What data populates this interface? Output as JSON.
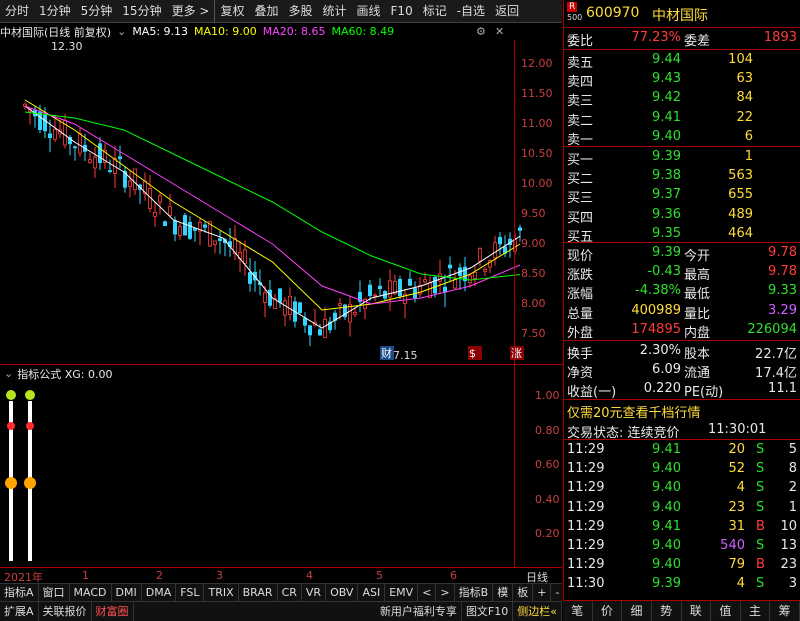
{
  "toolbar": {
    "items": [
      "分时",
      "1分钟",
      "5分钟",
      "15分钟",
      "更多 >",
      "复权",
      "叠加",
      "多股",
      "统计",
      "画线",
      "F10",
      "标记",
      "-自选",
      "返回"
    ]
  },
  "chart_header": {
    "title": "中材国际(日线 前复权)",
    "ma5": "MA5: 9.13",
    "ma10": "MA10: 9.00",
    "ma20": "MA20: 8.65",
    "ma60": "MA60: 8.49",
    "colors": {
      "ma5": "#ffffff",
      "ma10": "#ffff00",
      "ma20": "#ff40ff",
      "ma60": "#00ff00"
    }
  },
  "price_axis": {
    "ticks": [
      "12.00",
      "11.50",
      "11.00",
      "10.50",
      "10.00",
      "9.50",
      "9.00",
      "8.50",
      "8.00",
      "7.50"
    ],
    "high_label": "12.30",
    "low_label": "7.15",
    "markers": [
      "财",
      "$",
      "涨"
    ]
  },
  "indicator": {
    "title": "指标公式 XG: 0.00",
    "ticks": [
      "1.00",
      "0.80",
      "0.60",
      "0.40",
      "0.20"
    ]
  },
  "date_axis": {
    "labels": [
      "2021年",
      "1",
      "2",
      "3",
      "4",
      "5",
      "6"
    ],
    "right_label": "日线"
  },
  "tabs_row1": {
    "items": [
      "指标A",
      "窗口",
      "MACD",
      "DMI",
      "DMA",
      "FSL",
      "TRIX",
      "BRAR",
      "CR",
      "VR",
      "OBV",
      "ASI",
      "EMV",
      "<",
      ">",
      "指标B",
      "模",
      "板",
      "+",
      "-"
    ]
  },
  "tabs_row2": {
    "items": [
      "扩展A",
      "关联报价",
      "财富圈"
    ],
    "right_items": [
      "新用户福利专享",
      "图文F10",
      "侧边栏«"
    ]
  },
  "stock": {
    "r_badge": "R",
    "r_num": "500",
    "code": "600970",
    "name": "中材国际"
  },
  "order_book": {
    "wb_label": "委比",
    "wb_value": "77.23%",
    "wc_label": "委差",
    "wc_value": "1893",
    "asks": [
      {
        "label": "卖五",
        "price": "9.44",
        "vol": "104"
      },
      {
        "label": "卖四",
        "price": "9.43",
        "vol": "63"
      },
      {
        "label": "卖三",
        "price": "9.42",
        "vol": "84"
      },
      {
        "label": "卖二",
        "price": "9.41",
        "vol": "22"
      },
      {
        "label": "卖一",
        "price": "9.40",
        "vol": "6"
      }
    ],
    "bids": [
      {
        "label": "买一",
        "price": "9.39",
        "vol": "1"
      },
      {
        "label": "买二",
        "price": "9.38",
        "vol": "563"
      },
      {
        "label": "买三",
        "price": "9.37",
        "vol": "655"
      },
      {
        "label": "买四",
        "price": "9.36",
        "vol": "489"
      },
      {
        "label": "买五",
        "price": "9.35",
        "vol": "464"
      }
    ]
  },
  "quote": {
    "rows": [
      {
        "l1": "现价",
        "v1": "9.39",
        "c1": "green",
        "l2": "今开",
        "v2": "9.78",
        "c2": "red"
      },
      {
        "l1": "涨跌",
        "v1": "-0.43",
        "c1": "green",
        "l2": "最高",
        "v2": "9.78",
        "c2": "red"
      },
      {
        "l1": "涨幅",
        "v1": "-4.38%",
        "c1": "green",
        "l2": "最低",
        "v2": "9.33",
        "c2": "green"
      },
      {
        "l1": "总量",
        "v1": "400989",
        "c1": "yellow",
        "l2": "量比",
        "v2": "3.29",
        "c2": "purple"
      },
      {
        "l1": "外盘",
        "v1": "174895",
        "c1": "red",
        "l2": "内盘",
        "v2": "226094",
        "c2": "green"
      }
    ],
    "rows2": [
      {
        "l1": "换手",
        "v1": "2.30%",
        "l2": "股本",
        "v2": "22.7亿"
      },
      {
        "l1": "净资",
        "v1": "6.09",
        "l2": "流通",
        "v2": "17.4亿"
      },
      {
        "l1": "收益(一)",
        "v1": "0.220",
        "l2": "PE(动)",
        "v2": "11.1"
      }
    ]
  },
  "promo": "仅需20元查看千档行情",
  "trade_status": {
    "label": "交易状态: 连续竞价",
    "time": "11:30:01"
  },
  "ticks": [
    {
      "time": "11:29",
      "price": "9.41",
      "pc": "green",
      "vol": "20",
      "vc": "yellow",
      "bs": "S",
      "bsc": "green",
      "n": "5"
    },
    {
      "time": "11:29",
      "price": "9.40",
      "pc": "green",
      "vol": "52",
      "vc": "yellow",
      "bs": "S",
      "bsc": "green",
      "n": "8"
    },
    {
      "time": "11:29",
      "price": "9.40",
      "pc": "green",
      "vol": "4",
      "vc": "yellow",
      "bs": "S",
      "bsc": "green",
      "n": "2"
    },
    {
      "time": "11:29",
      "price": "9.40",
      "pc": "green",
      "vol": "23",
      "vc": "yellow",
      "bs": "S",
      "bsc": "green",
      "n": "1"
    },
    {
      "time": "11:29",
      "price": "9.41",
      "pc": "green",
      "vol": "31",
      "vc": "yellow",
      "bs": "B",
      "bsc": "red",
      "n": "10"
    },
    {
      "time": "11:29",
      "price": "9.40",
      "pc": "green",
      "vol": "540",
      "vc": "purple",
      "bs": "S",
      "bsc": "green",
      "n": "13"
    },
    {
      "time": "11:29",
      "price": "9.40",
      "pc": "green",
      "vol": "79",
      "vc": "yellow",
      "bs": "B",
      "bsc": "red",
      "n": "23"
    },
    {
      "time": "11:30",
      "price": "9.39",
      "pc": "green",
      "vol": "4",
      "vc": "yellow",
      "bs": "S",
      "bsc": "green",
      "n": "3"
    }
  ],
  "bottom_nav": [
    "笔",
    "价",
    "细",
    "势",
    "联",
    "值",
    "主",
    "筹"
  ],
  "chart_data": {
    "type": "line",
    "title": "中材国际(日线 前复权)",
    "ylim": [
      7.0,
      12.4
    ],
    "x": [
      "2021-01",
      "2021-02",
      "2021-03",
      "2021-04",
      "2021-05",
      "2021-06"
    ],
    "series": [
      {
        "name": "MA5",
        "values": [
          11.3,
          10.7,
          10.2,
          9.4,
          9.1,
          8.1,
          7.6,
          8.1,
          8.3,
          8.6,
          9.13
        ]
      },
      {
        "name": "MA10",
        "values": [
          11.4,
          10.9,
          10.3,
          9.7,
          9.2,
          8.7,
          7.9,
          8.0,
          8.2,
          8.5,
          9.0
        ]
      },
      {
        "name": "MA20",
        "values": [
          11.3,
          11.0,
          10.5,
          10.0,
          9.5,
          9.0,
          8.3,
          8.0,
          8.1,
          8.3,
          8.65
        ]
      },
      {
        "name": "MA60",
        "values": [
          11.2,
          11.1,
          10.9,
          10.5,
          10.1,
          9.7,
          9.2,
          8.8,
          8.5,
          8.4,
          8.49
        ]
      }
    ]
  }
}
